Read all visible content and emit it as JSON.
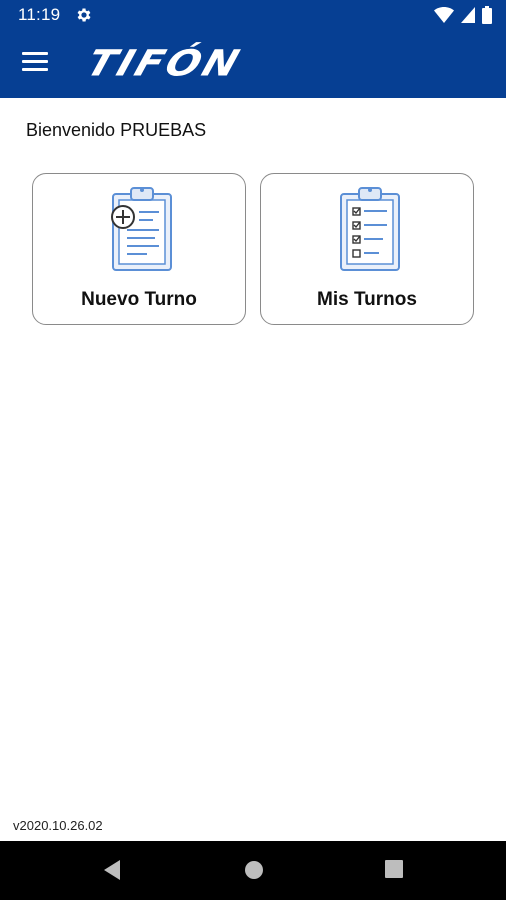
{
  "status_bar": {
    "time": "11:19",
    "icons": [
      "gear-icon",
      "wifi-icon",
      "signal-icon",
      "battery-icon"
    ]
  },
  "app_bar": {
    "menu_icon": "menu-icon",
    "logo_text": "TIFÓN",
    "color": "#063f93"
  },
  "welcome_text": "Bienvenido PRUEBAS",
  "cards": [
    {
      "label": "Nuevo Turno",
      "icon": "clipboard-add-icon"
    },
    {
      "label": "Mis Turnos",
      "icon": "clipboard-checklist-icon"
    }
  ],
  "version": "v2020.10.26.02",
  "nav_bar": {
    "buttons": [
      "back-icon",
      "home-icon",
      "recents-icon"
    ]
  }
}
